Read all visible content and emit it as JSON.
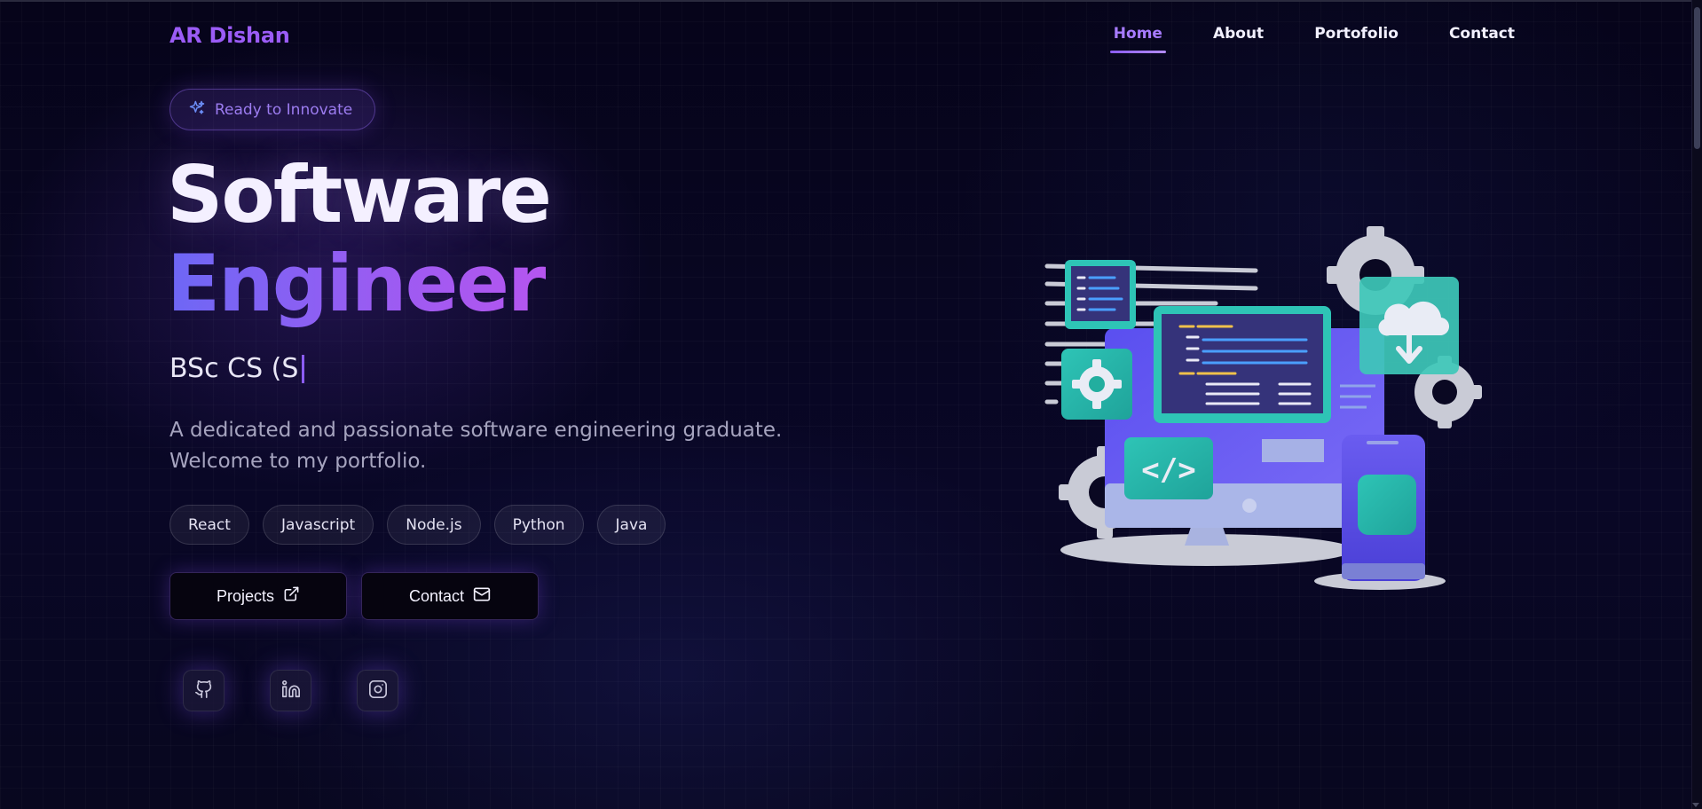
{
  "nav": {
    "brand": "AR Dishan",
    "links": [
      {
        "label": "Home",
        "active": true
      },
      {
        "label": "About",
        "active": false
      },
      {
        "label": "Portofolio",
        "active": false
      },
      {
        "label": "Contact",
        "active": false
      }
    ]
  },
  "hero": {
    "badge": {
      "label": "Ready to Innovate",
      "icon": "sparkles-icon"
    },
    "title_line1": "Software",
    "title_line2": "Engineer",
    "typed_text": "BSc CS (S",
    "description": "A dedicated and passionate software engineering graduate. Welcome to my portfolio.",
    "tags": [
      "React",
      "Javascript",
      "Node.js",
      "Python",
      "Java"
    ],
    "buttons": [
      {
        "label": "Projects",
        "icon": "external-link-icon"
      },
      {
        "label": "Contact",
        "icon": "mail-icon"
      }
    ],
    "socials": [
      {
        "name": "github",
        "icon": "github-icon"
      },
      {
        "name": "linkedin",
        "icon": "linkedin-icon"
      },
      {
        "name": "instagram",
        "icon": "instagram-icon"
      }
    ]
  },
  "colors": {
    "accent": "#8b5cf6",
    "background": "#07051a",
    "gradient_start": "#6d67f5",
    "gradient_end": "#b655ef"
  }
}
